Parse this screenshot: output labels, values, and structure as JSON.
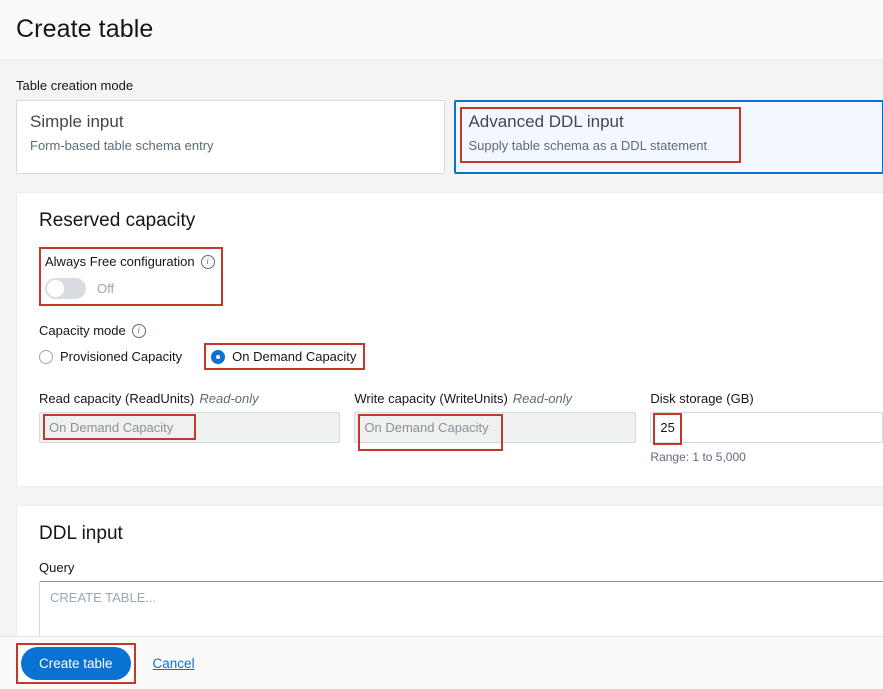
{
  "header": {
    "title": "Create table"
  },
  "mode_section": {
    "label": "Table creation mode",
    "cards": [
      {
        "title": "Simple input",
        "description": "Form-based table schema entry",
        "selected": false
      },
      {
        "title": "Advanced DDL input",
        "description": "Supply table schema as a DDL statement",
        "selected": true
      }
    ]
  },
  "reserved_capacity": {
    "title": "Reserved capacity",
    "always_free": {
      "label": "Always Free configuration",
      "info_icon": "info-icon",
      "toggle_state": "Off"
    },
    "capacity_mode": {
      "label": "Capacity mode",
      "info_icon": "info-icon",
      "options": [
        {
          "label": "Provisioned Capacity",
          "checked": false
        },
        {
          "label": "On Demand Capacity",
          "checked": true
        }
      ]
    },
    "read_capacity": {
      "label": "Read capacity (ReadUnits)",
      "readonly_tag": "Read-only",
      "value": "On Demand Capacity"
    },
    "write_capacity": {
      "label": "Write capacity (WriteUnits)",
      "readonly_tag": "Read-only",
      "value": "On Demand Capacity"
    },
    "disk_storage": {
      "label": "Disk storage (GB)",
      "value": "25",
      "hint": "Range: 1 to 5,000"
    }
  },
  "ddl_input": {
    "title": "DDL input",
    "query_label": "Query",
    "query_placeholder": "CREATE TABLE..."
  },
  "footer": {
    "create_label": "Create table",
    "cancel_label": "Cancel"
  },
  "colors": {
    "accent": "#0972d3",
    "annotation": "#c0392b",
    "page_background": "#f4f4f4",
    "panel_background": "#ffffff",
    "selected_card_background": "#f2f8fd"
  }
}
